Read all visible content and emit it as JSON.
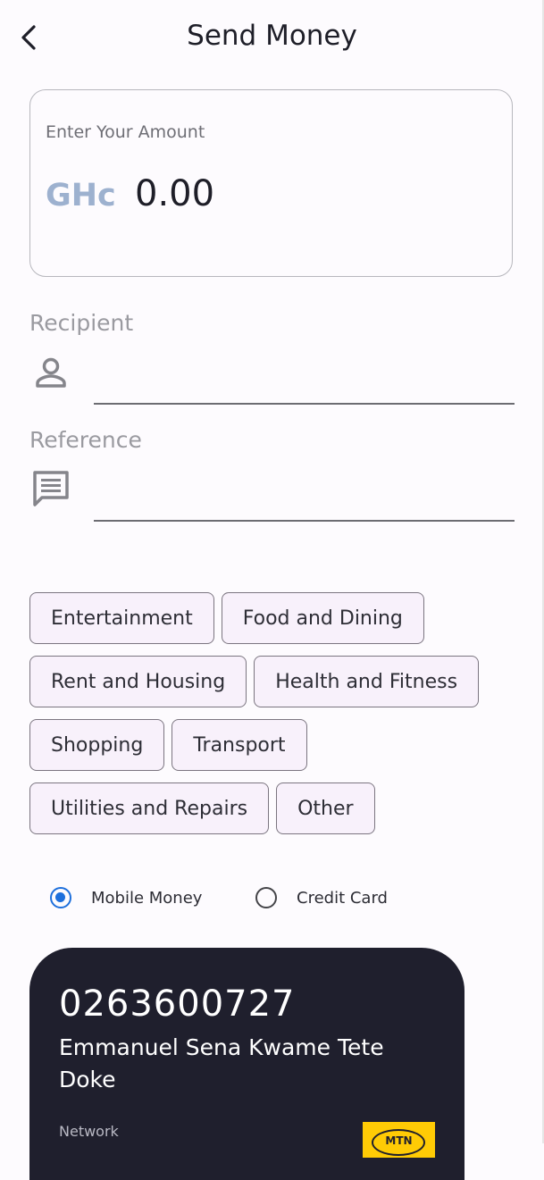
{
  "header": {
    "title": "Send Money",
    "back_icon": "chevron-left-icon"
  },
  "amount": {
    "label": "Enter Your Amount",
    "currency": "GHc",
    "value": "0.00"
  },
  "recipient": {
    "label": "Recipient",
    "value": "",
    "icon": "person-icon"
  },
  "reference": {
    "label": "Reference",
    "value": "",
    "icon": "message-icon"
  },
  "categories": {
    "items": [
      "Entertainment",
      "Food and Dining",
      "Rent and Housing",
      "Health and Fitness",
      "Shopping",
      "Transport",
      "Utilities and Repairs",
      "Other"
    ]
  },
  "payment_method": {
    "options": [
      {
        "label": "Mobile Money",
        "selected": true
      },
      {
        "label": "Credit Card",
        "selected": false
      }
    ],
    "accent": "#1d6fdc"
  },
  "wallet": {
    "number": "0263600727",
    "name": "Emmanuel Sena Kwame Tete Doke",
    "network_label": "Network",
    "network_logo_text": "MTN",
    "network_logo_color": "#ffcb05"
  },
  "colors": {
    "card_bg": "#1f1f2d",
    "chip_bg": "#f8f1fb",
    "currency": "#9db1cf"
  }
}
